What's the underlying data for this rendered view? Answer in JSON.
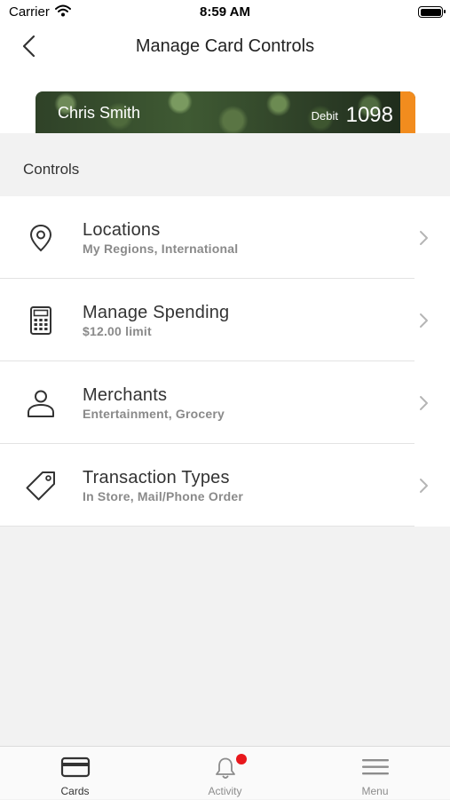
{
  "status_bar": {
    "carrier": "Carrier",
    "time": "8:59 AM"
  },
  "nav": {
    "title": "Manage Card Controls"
  },
  "card": {
    "holder": "Chris Smith",
    "type": "Debit",
    "last4": "1098",
    "accent_color": "#f28c1e"
  },
  "section": {
    "title": "Controls"
  },
  "controls": [
    {
      "label": "Locations",
      "detail": "My Regions, International",
      "icon": "location-pin-icon"
    },
    {
      "label": "Manage Spending",
      "detail": "$12.00 limit",
      "icon": "calculator-icon"
    },
    {
      "label": "Merchants",
      "detail": "Entertainment, Grocery",
      "icon": "person-icon"
    },
    {
      "label": "Transaction Types",
      "detail": "In Store, Mail/Phone Order",
      "icon": "tag-icon"
    }
  ],
  "tabbar": {
    "tabs": [
      {
        "label": "Cards",
        "icon": "card-icon",
        "active": true
      },
      {
        "label": "Activity",
        "icon": "bell-icon",
        "badge": true
      },
      {
        "label": "Menu",
        "icon": "hamburger-icon"
      }
    ],
    "badge_color": "#e8171c"
  }
}
